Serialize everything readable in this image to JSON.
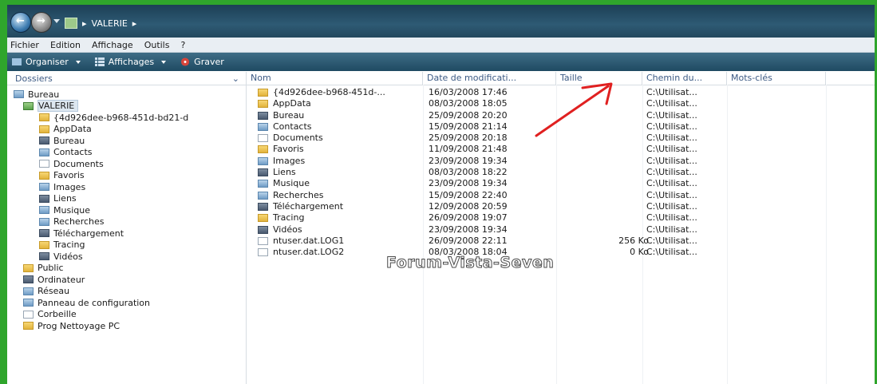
{
  "address": {
    "segments": [
      "VALERIE"
    ]
  },
  "menu": [
    "Fichier",
    "Edition",
    "Affichage",
    "Outils",
    "?"
  ],
  "toolbar": {
    "organiser": "Organiser",
    "affichages": "Affichages",
    "graver": "Graver"
  },
  "folders_header": "Dossiers",
  "tree": [
    {
      "label": "Bureau",
      "level": 0,
      "icon": "blue"
    },
    {
      "label": "VALERIE",
      "level": 1,
      "icon": "user",
      "selected": true
    },
    {
      "label": "{4d926dee-b968-451d-bd21-d",
      "level": 2,
      "icon": "folder"
    },
    {
      "label": "AppData",
      "level": 2,
      "icon": "folder"
    },
    {
      "label": "Bureau",
      "level": 2,
      "icon": "dark"
    },
    {
      "label": "Contacts",
      "level": 2,
      "icon": "blue"
    },
    {
      "label": "Documents",
      "level": 2,
      "icon": "doc"
    },
    {
      "label": "Favoris",
      "level": 2,
      "icon": "folder"
    },
    {
      "label": "Images",
      "level": 2,
      "icon": "blue"
    },
    {
      "label": "Liens",
      "level": 2,
      "icon": "dark"
    },
    {
      "label": "Musique",
      "level": 2,
      "icon": "blue"
    },
    {
      "label": "Recherches",
      "level": 2,
      "icon": "blue"
    },
    {
      "label": "Téléchargement",
      "level": 2,
      "icon": "dark"
    },
    {
      "label": "Tracing",
      "level": 2,
      "icon": "folder"
    },
    {
      "label": "Vidéos",
      "level": 2,
      "icon": "dark"
    },
    {
      "label": "Public",
      "level": 1,
      "icon": "folder"
    },
    {
      "label": "Ordinateur",
      "level": 1,
      "icon": "dark"
    },
    {
      "label": "Réseau",
      "level": 1,
      "icon": "blue"
    },
    {
      "label": "Panneau de configuration",
      "level": 1,
      "icon": "blue"
    },
    {
      "label": "Corbeille",
      "level": 1,
      "icon": "doc"
    },
    {
      "label": "Prog Nettoyage PC",
      "level": 1,
      "icon": "folder"
    }
  ],
  "columns": [
    "Nom",
    "Date de modificati...",
    "Taille",
    "Chemin du...",
    "Mots-clés"
  ],
  "files": [
    {
      "name": "{4d926dee-b968-451d-...",
      "date": "16/03/2008 17:46",
      "size": "",
      "path": "C:\\Utilisat...",
      "icon": "folder"
    },
    {
      "name": "AppData",
      "date": "08/03/2008 18:05",
      "size": "",
      "path": "C:\\Utilisat...",
      "icon": "folder"
    },
    {
      "name": "Bureau",
      "date": "25/09/2008 20:20",
      "size": "",
      "path": "C:\\Utilisat...",
      "icon": "dark"
    },
    {
      "name": "Contacts",
      "date": "15/09/2008 21:14",
      "size": "",
      "path": "C:\\Utilisat...",
      "icon": "blue"
    },
    {
      "name": "Documents",
      "date": "25/09/2008 20:18",
      "size": "",
      "path": "C:\\Utilisat...",
      "icon": "doc"
    },
    {
      "name": "Favoris",
      "date": "11/09/2008 21:48",
      "size": "",
      "path": "C:\\Utilisat...",
      "icon": "folder"
    },
    {
      "name": "Images",
      "date": "23/09/2008 19:34",
      "size": "",
      "path": "C:\\Utilisat...",
      "icon": "blue"
    },
    {
      "name": "Liens",
      "date": "08/03/2008 18:22",
      "size": "",
      "path": "C:\\Utilisat...",
      "icon": "dark"
    },
    {
      "name": "Musique",
      "date": "23/09/2008 19:34",
      "size": "",
      "path": "C:\\Utilisat...",
      "icon": "blue"
    },
    {
      "name": "Recherches",
      "date": "15/09/2008 22:40",
      "size": "",
      "path": "C:\\Utilisat...",
      "icon": "blue"
    },
    {
      "name": "Téléchargement",
      "date": "12/09/2008 20:59",
      "size": "",
      "path": "C:\\Utilisat...",
      "icon": "dark"
    },
    {
      "name": "Tracing",
      "date": "26/09/2008 19:07",
      "size": "",
      "path": "C:\\Utilisat...",
      "icon": "folder"
    },
    {
      "name": "Vidéos",
      "date": "23/09/2008 19:34",
      "size": "",
      "path": "C:\\Utilisat...",
      "icon": "dark"
    },
    {
      "name": "ntuser.dat.LOG1",
      "date": "26/09/2008 22:11",
      "size": "256 Ko",
      "path": "C:\\Utilisat...",
      "icon": "doc"
    },
    {
      "name": "ntuser.dat.LOG2",
      "date": "08/03/2008 18:04",
      "size": "0 Ko",
      "path": "C:\\Utilisat...",
      "icon": "doc"
    }
  ],
  "watermark": "Forum-Vista-Seven",
  "colors": {
    "frame": "#2fa52c",
    "annotation_arrow": "#e02020",
    "toolbar": "#2c5a73"
  }
}
